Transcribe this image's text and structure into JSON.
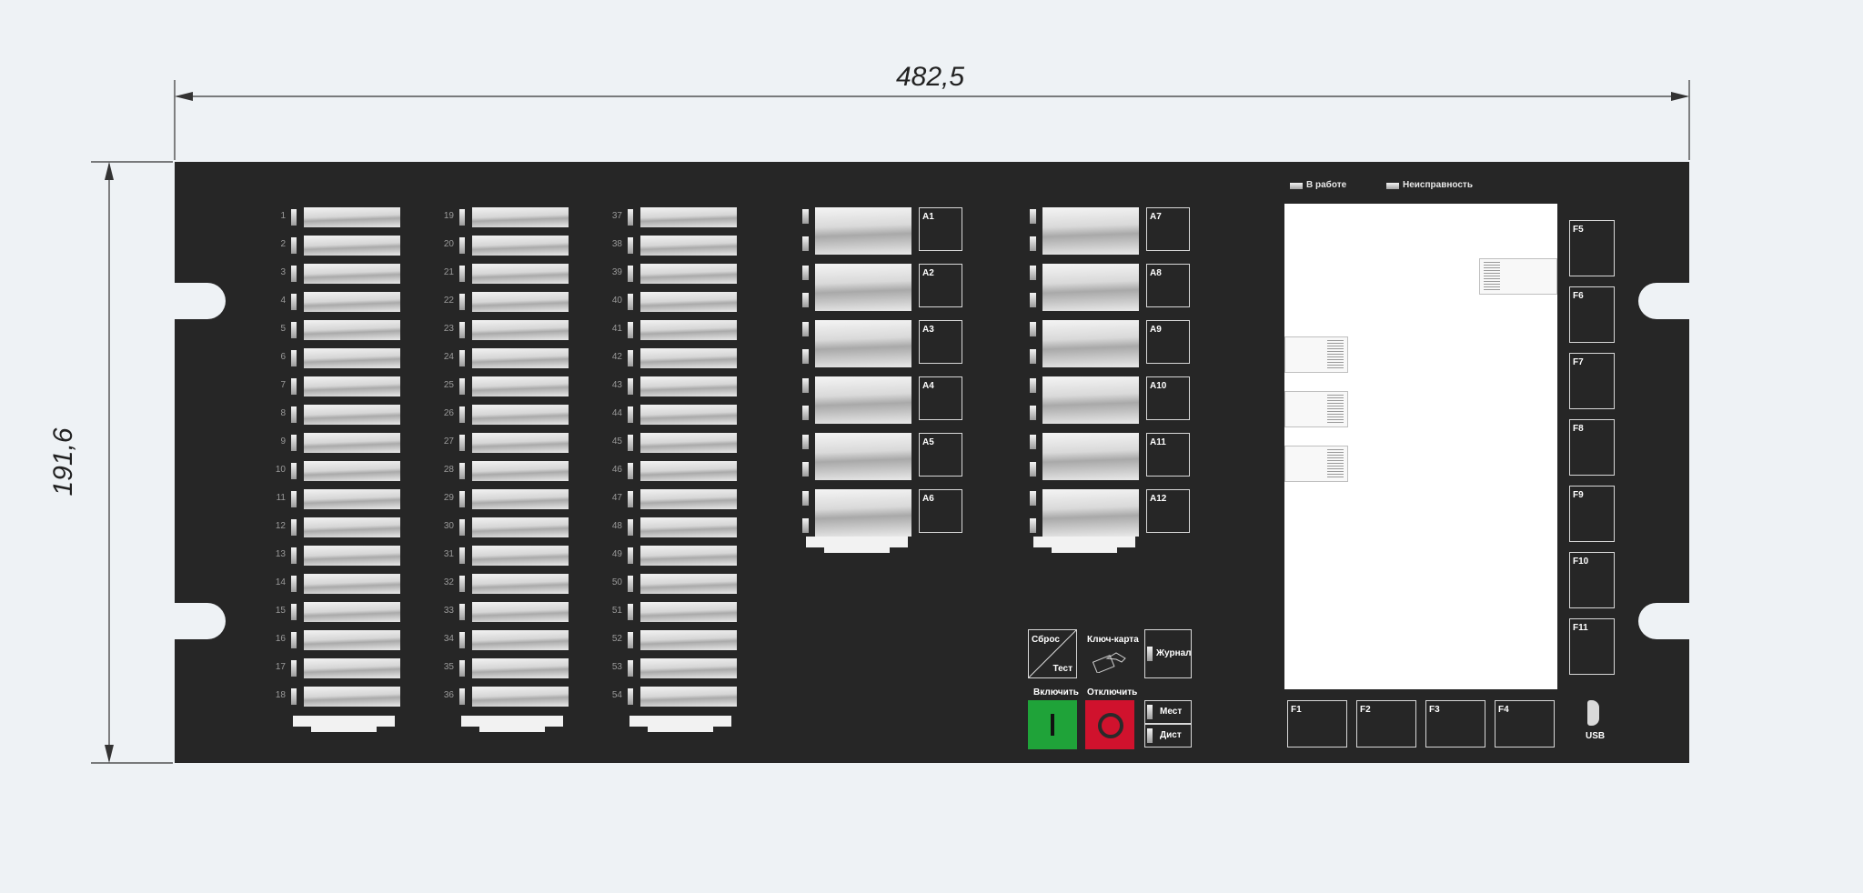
{
  "dimensions": {
    "width_label": "482,5",
    "height_label": "191,6"
  },
  "status": {
    "running": "В работе",
    "fault": "Неисправность"
  },
  "columns": [
    {
      "numbers": [
        "1",
        "2",
        "3",
        "4",
        "5",
        "6",
        "7",
        "8",
        "9",
        "10",
        "11",
        "12",
        "13",
        "14",
        "15",
        "16",
        "17",
        "18"
      ]
    },
    {
      "numbers": [
        "19",
        "20",
        "21",
        "22",
        "23",
        "24",
        "25",
        "26",
        "27",
        "28",
        "29",
        "30",
        "31",
        "32",
        "33",
        "34",
        "35",
        "36"
      ]
    },
    {
      "numbers": [
        "37",
        "38",
        "39",
        "40",
        "41",
        "42",
        "43",
        "44",
        "45",
        "46",
        "47",
        "48",
        "49",
        "50",
        "51",
        "52",
        "53",
        "54"
      ]
    }
  ],
  "a_buttons": {
    "left": [
      "A1",
      "A2",
      "A3",
      "A4",
      "A5",
      "A6"
    ],
    "right": [
      "A7",
      "A8",
      "A9",
      "A10",
      "A11",
      "A12"
    ]
  },
  "f_buttons": {
    "side": [
      "F5",
      "F6",
      "F7",
      "F8",
      "F9",
      "F10",
      "F11"
    ],
    "bottom": [
      "F1",
      "F2",
      "F3",
      "F4"
    ]
  },
  "controls": {
    "reset": "Сброс",
    "test": "Тест",
    "key_card": "Ключ-карта",
    "journal": "Журнал",
    "on_label": "Включить",
    "off_label": "Отключить",
    "local": "Мест",
    "remote": "Дист",
    "usb": "USB"
  },
  "colors": {
    "panel": "#262626",
    "on_button": "#1fa339",
    "off_button": "#d0122d"
  }
}
